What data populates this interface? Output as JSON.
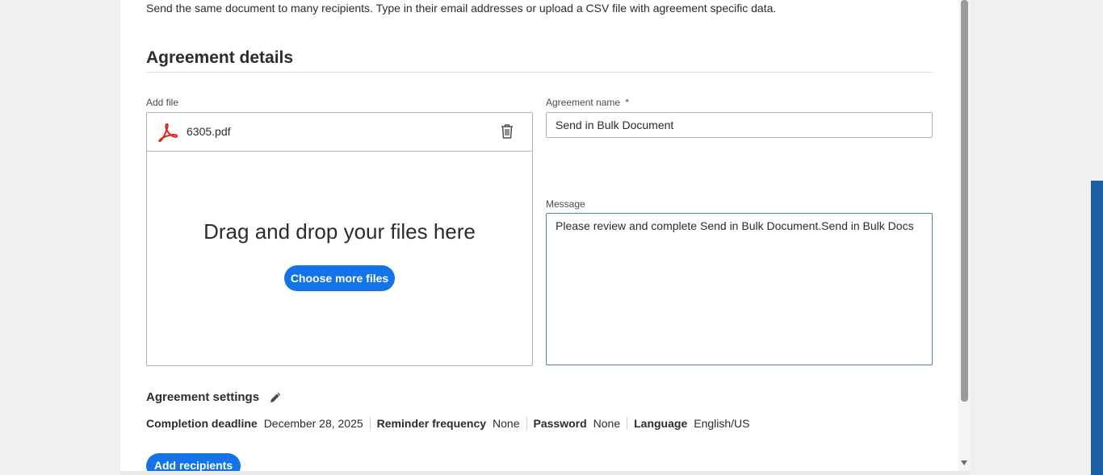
{
  "intro_text": "Send the same document to many recipients. Type in their email addresses or upload a CSV file with agreement specific data.",
  "agreement_details": {
    "title": "Agreement details",
    "add_file_label": "Add file",
    "file": {
      "name": "6305.pdf",
      "icon": "pdf-icon"
    },
    "drop_text": "Drag and drop your files here",
    "choose_button": "Choose more files",
    "agreement_name_label": "Agreement name",
    "required_marker": "*",
    "agreement_name_value": "Send in Bulk Document",
    "message_label": "Message",
    "message_value": "Please review and complete Send in Bulk Document.Send in Bulk Docs"
  },
  "agreement_settings": {
    "title": "Agreement settings",
    "items": [
      {
        "key": "Completion deadline",
        "value": "December 28, 2025"
      },
      {
        "key": "Reminder frequency",
        "value": "None"
      },
      {
        "key": "Password",
        "value": "None"
      },
      {
        "key": "Language",
        "value": "English/US"
      }
    ]
  },
  "add_recipients_button": "Add recipients",
  "colors": {
    "accent": "#1473e6",
    "pdf_red": "#e1251b",
    "side_strip": "#1d5fa3"
  }
}
